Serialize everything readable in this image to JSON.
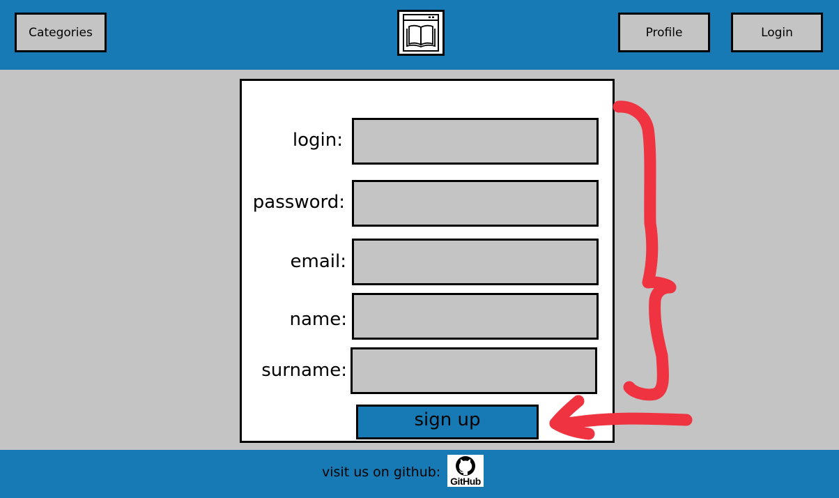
{
  "header": {
    "categories_label": "Categories",
    "profile_label": "Profile",
    "login_label": "Login",
    "logo_icon": "book-window-icon"
  },
  "form": {
    "fields": [
      {
        "label": "login:",
        "value": ""
      },
      {
        "label": "password:",
        "value": ""
      },
      {
        "label": "email:",
        "value": ""
      },
      {
        "label": "name:",
        "value": ""
      },
      {
        "label": "surname:",
        "value": ""
      }
    ],
    "submit_label": "sign up"
  },
  "annotation": {
    "shape": "hand-drawn red brace and arrow pointing to submit button",
    "color": "#ef3340"
  },
  "footer": {
    "text": "visit us on github:",
    "github_logo_text": "GitHub"
  },
  "colors": {
    "brand_blue": "#177ab4",
    "surface_gray": "#c4c4c4",
    "card_white": "#ffffff"
  }
}
